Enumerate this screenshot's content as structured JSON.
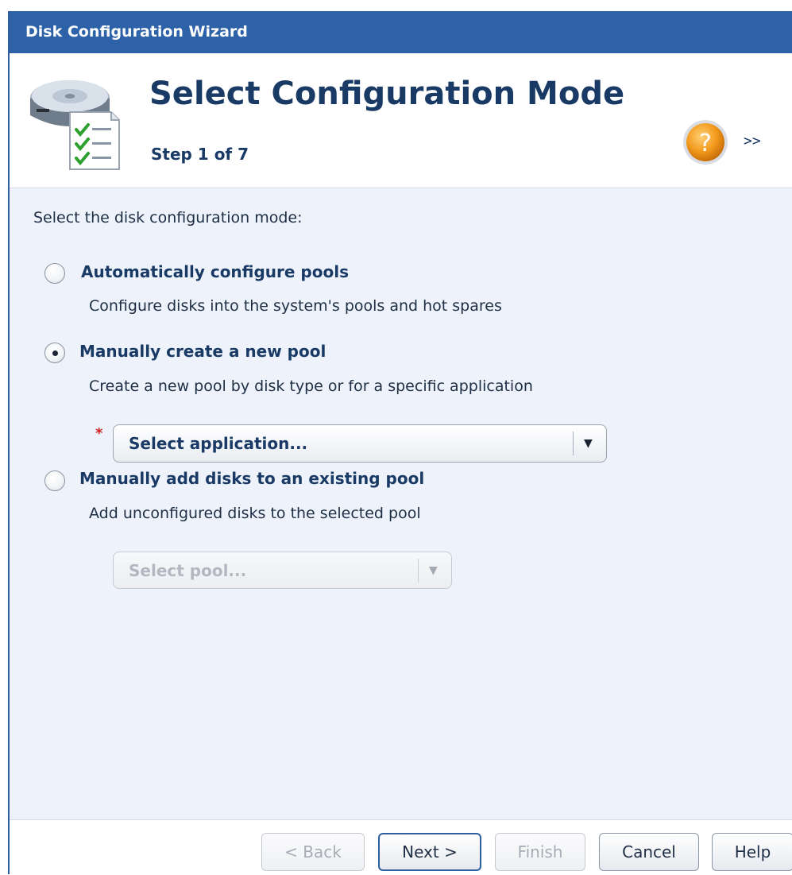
{
  "window": {
    "title": "Disk Configuration Wizard"
  },
  "header": {
    "title": "Select Configuration Mode",
    "step": "Step 1 of 7",
    "help_icon": "help-question-icon",
    "expand_label": ">>"
  },
  "content": {
    "prompt": "Select the disk configuration mode:",
    "options": [
      {
        "label": "Automatically configure pools",
        "description": "Configure disks into the system's pools and hot spares",
        "selected": false
      },
      {
        "label": "Manually create a new pool",
        "description": "Create a new pool by disk type or for a specific application",
        "selected": true
      },
      {
        "label": "Manually add disks to an existing pool",
        "description": "Add unconfigured disks to the selected pool",
        "selected": false
      }
    ],
    "application_select": {
      "value": "Select application...",
      "required_marker": "*",
      "enabled": true
    },
    "pool_select": {
      "value": "Select pool...",
      "enabled": false
    }
  },
  "footer": {
    "back": "< Back",
    "next": "Next >",
    "finish": "Finish",
    "cancel": "Cancel",
    "help": "Help"
  },
  "colors": {
    "titlebar": "#2e62a8",
    "heading": "#1a3a66",
    "panel_background": "#eef3fb",
    "required": "#cc2222"
  }
}
